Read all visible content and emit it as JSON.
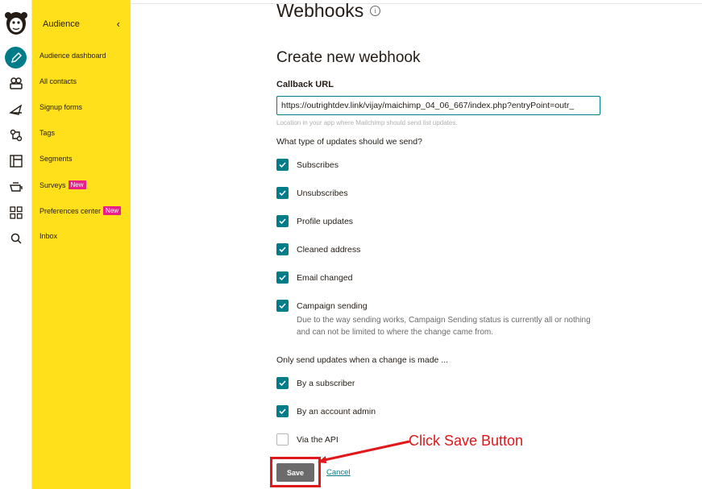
{
  "sidebar": {
    "header": "Audience",
    "collapse_icon": "chevron-left-icon",
    "items": [
      {
        "label": "Audience dashboard"
      },
      {
        "label": "All contacts"
      },
      {
        "label": "Signup forms"
      },
      {
        "label": "Tags"
      },
      {
        "label": "Segments"
      },
      {
        "label": "Surveys",
        "badge": "New"
      },
      {
        "label": "Preferences center",
        "badge": "New"
      },
      {
        "label": "Inbox"
      }
    ]
  },
  "rail": {
    "icons": [
      "mailchimp-logo",
      "pencil-icon",
      "audience-icon",
      "campaigns-icon",
      "automations-icon",
      "website-icon",
      "content-icon",
      "integrations-icon",
      "search-icon"
    ]
  },
  "page": {
    "title": "Webhooks",
    "info_icon": "i",
    "section_title": "Create new webhook",
    "callback_label": "Callback URL",
    "callback_value": "https://outrightdev.link/vijay/maichimp_04_06_667/index.php?entryPoint=outr_",
    "callback_helper": "Location in your app where Mailchimp should send list updates.",
    "updates_question": "What type of updates should we send?",
    "update_types": [
      {
        "label": "Subscribes",
        "checked": true
      },
      {
        "label": "Unsubscribes",
        "checked": true
      },
      {
        "label": "Profile updates",
        "checked": true
      },
      {
        "label": "Cleaned address",
        "checked": true
      },
      {
        "label": "Email changed",
        "checked": true
      },
      {
        "label": "Campaign sending",
        "checked": true
      }
    ],
    "campaign_note": "Due to the way sending works, Campaign Sending status is currently all or nothing and can not be limited to where the change came from.",
    "source_question": "Only send updates when a change is made ...",
    "sources": [
      {
        "label": "By a subscriber",
        "checked": true
      },
      {
        "label": "By an account admin",
        "checked": true
      },
      {
        "label": "Via the API",
        "checked": false
      }
    ],
    "save_label": "Save",
    "cancel_label": "Cancel"
  },
  "annotation": {
    "text": "Click Save Button",
    "color": "#e0171b"
  },
  "colors": {
    "accent": "#007c89",
    "sidebar_bg": "#ffe01b",
    "badge": "#e91e8a",
    "save_button": "#6b6b6b"
  }
}
